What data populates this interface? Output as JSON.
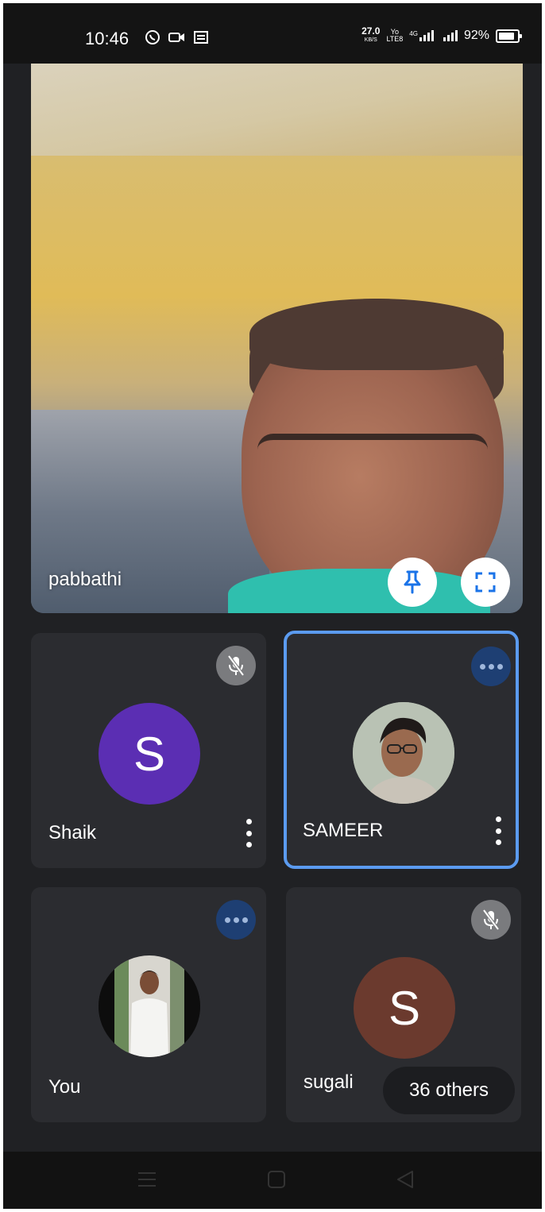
{
  "status_bar": {
    "time": "10:46",
    "net_speed": "27.0",
    "net_speed_unit": "KB/S",
    "volte_top": "Yo",
    "volte_bottom": "LTE8",
    "network_label": "4G",
    "battery_percent": "92%",
    "battery_level": 0.92,
    "icons": [
      "whatsapp-icon",
      "video-camera-icon",
      "message-icon",
      "signal-icon",
      "battery-icon"
    ]
  },
  "main_video": {
    "participant_name": "pabbathi",
    "pin_icon": "pin-icon",
    "fullscreen_icon": "fullscreen-icon"
  },
  "tiles": [
    {
      "name": "Shaik",
      "avatar_letter": "S",
      "avatar_color": "#5b2eb3",
      "status": "muted"
    },
    {
      "name": "SAMEER",
      "avatar": "photo",
      "status": "speaking",
      "highlight_color": "#5b9bf0"
    },
    {
      "name": "You",
      "avatar": "photo",
      "status": "speaking"
    },
    {
      "name": "sugali",
      "avatar_letter": "S",
      "avatar_color": "#6b3a2e",
      "status": "muted",
      "others_label": "36 others"
    }
  ],
  "colors": {
    "background": "#202124",
    "tile": "#2b2c30",
    "speaking_badge": "#1e3f73",
    "mute_badge": "#7a7b7e"
  }
}
